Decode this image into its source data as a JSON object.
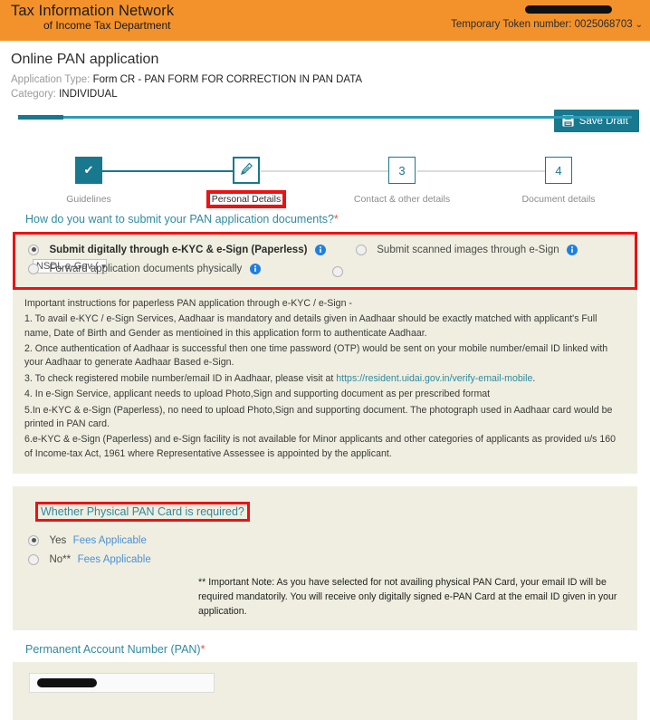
{
  "header": {
    "logo_line1": "Tax Information Network",
    "logo_line2": "of Income Tax Department",
    "token_text": "Temporary Token number: 0025068703",
    "token_caret": "⌄",
    "brand_color": "#f3922b"
  },
  "page": {
    "title": "Online PAN application",
    "application_type_label": "Application Type:",
    "application_type_value": "Form CR - PAN FORM FOR CORRECTION IN PAN DATA",
    "category_label": "Category:",
    "category_value": "INDIVIDUAL",
    "save_draft_label": "Save Draft",
    "accent_color": "#17788e"
  },
  "stepper": {
    "steps": [
      {
        "marker": "✔",
        "label": "Guidelines",
        "state": "done"
      },
      {
        "marker": "✎",
        "label": "Personal Details",
        "state": "current"
      },
      {
        "marker": "3",
        "label": "Contact & other details",
        "state": "upcoming"
      },
      {
        "marker": "4",
        "label": "Document details",
        "state": "upcoming"
      }
    ],
    "highlight_color": "#ee1111"
  },
  "submit_section": {
    "question": "How do you want to submit your PAN application documents?",
    "required_mark": "*",
    "options": [
      {
        "label": "Submit digitally through e-KYC & e-Sign (Paperless)",
        "checked": true
      },
      {
        "label": "Submit scanned images through e-Sign",
        "checked": false
      },
      {
        "label": "Forward application documents physically",
        "checked": false
      }
    ],
    "select_value": "NSDL e-Gov (",
    "select_caret": "▼"
  },
  "instructions": {
    "heading": "Important instructions for paperless PAN application through e-KYC / e-Sign -",
    "items": [
      "1. To avail e-KYC / e-Sign Services, Aadhaar is mandatory and details given in Aadhaar should be exactly matched with applicant's Full name, Date of Birth and Gender as mentioined in this application form to authenticate Aadhaar.",
      "2. Once authentication of Aadhaar is successful then one time password (OTP) would be sent on your mobile number/email ID linked with your Aadhaar to generate Aadhaar Based e-Sign.",
      "4. In e-Sign Service, applicant needs to upload Photo,Sign and supporting document as per prescribed format",
      "5.In e-KYC & e-Sign (Paperless), no need to upload Photo,Sign and supporting document. The photograph used in Aadhaar card would be printed in PAN card.",
      "6.e-KYC & e-Sign (Paperless) and e-Sign facility is not available for Minor applicants and other categories of applicants as provided u/s 160 of Income-tax Act, 1961 where Representative Assessee is appointed by the applicant."
    ],
    "item3_prefix": "3. To check registered mobile number/email ID in Aadhaar, please visit at ",
    "item3_link": "https://resident.uidai.gov.in/verify-email-mobile",
    "item3_suffix": "."
  },
  "physical_card_section": {
    "question": "Whether Physical PAN Card is required?",
    "options": [
      {
        "label": "Yes",
        "link": "Fees Applicable",
        "checked": true
      },
      {
        "label": "No**",
        "link": "Fees Applicable",
        "checked": false
      }
    ],
    "note": "** Important Note: As you have selected for not availing physical PAN Card, your email ID will be required mandatorily. You will receive only digitally signed e-PAN Card at the email ID given in your application."
  },
  "pan_section": {
    "label": "Permanent Account Number (PAN)",
    "required_mark": "*",
    "value": ""
  }
}
